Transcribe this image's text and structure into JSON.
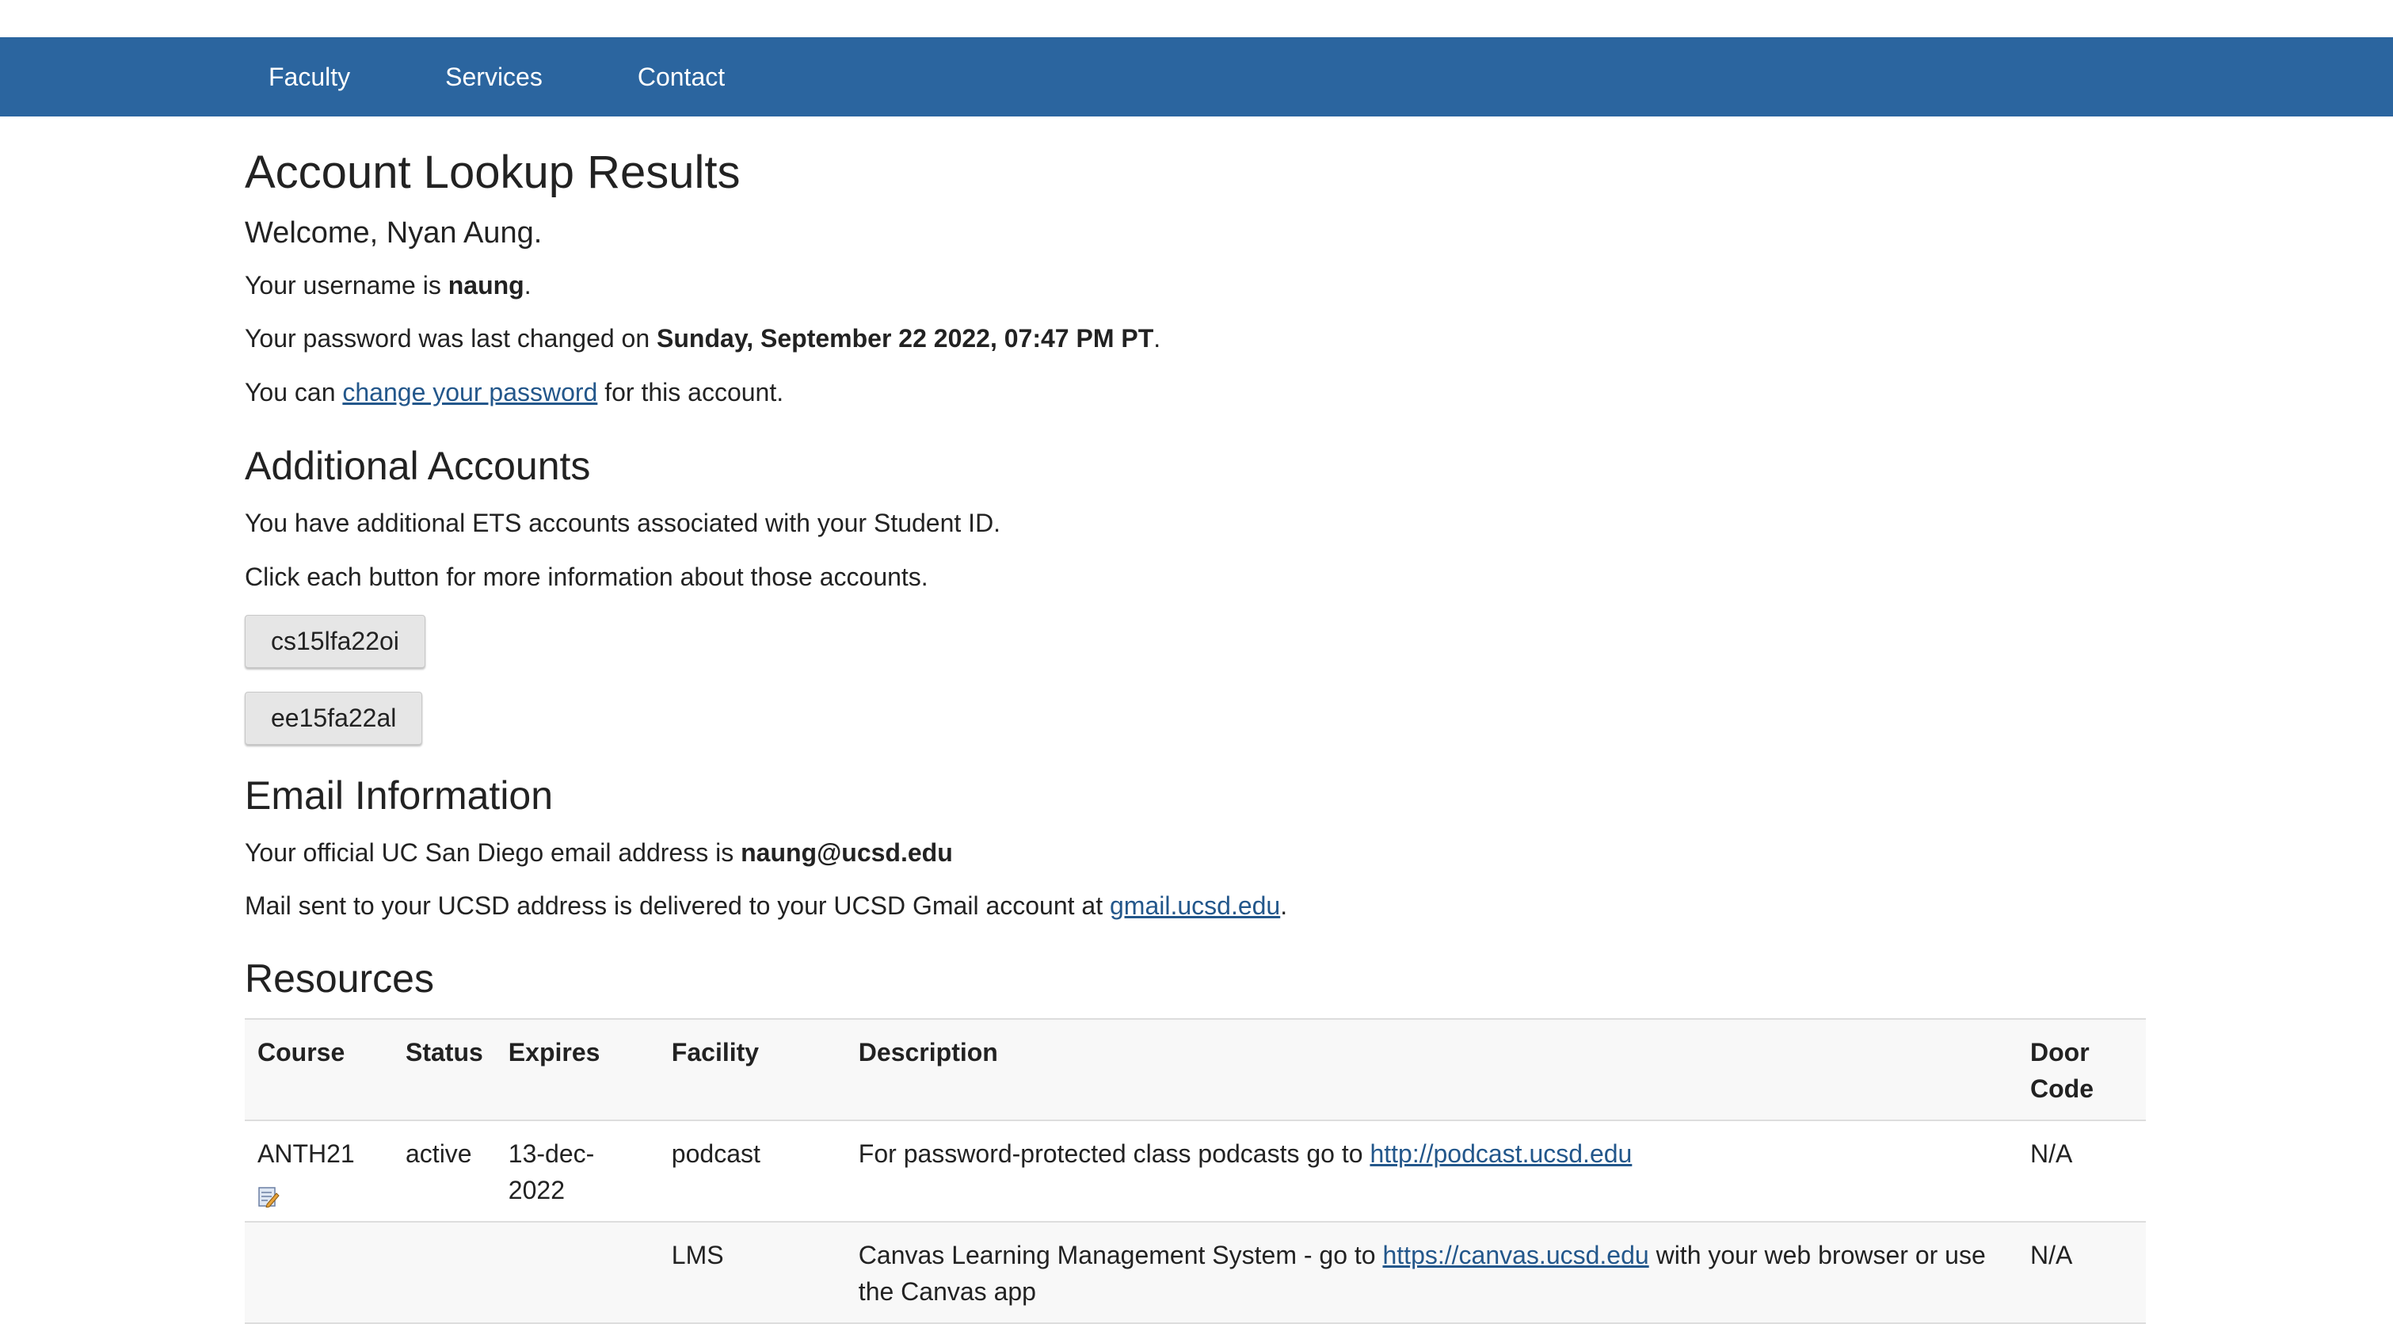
{
  "nav": {
    "items": [
      "Faculty",
      "Services",
      "Contact"
    ]
  },
  "page": {
    "title": "Account Lookup Results",
    "welcome": "Welcome, Nyan Aung."
  },
  "account": {
    "username_prefix": "Your username is ",
    "username": "naung",
    "password_prefix": "Your password was last changed on ",
    "password_changed": "Sunday, September 22 2022, 07:47 PM PT",
    "change_prefix": "You can ",
    "change_link": "change your password",
    "change_suffix": " for this account."
  },
  "additional": {
    "heading": "Additional Accounts",
    "line1": "You have additional ETS accounts associated with your Student ID.",
    "line2": "Click each button for more information about those accounts.",
    "buttons": [
      "cs15lfa22oi",
      "ee15fa22al"
    ]
  },
  "email": {
    "heading": "Email Information",
    "line1_prefix": "Your official UC San Diego email address is ",
    "address": "naung@ucsd.edu",
    "line2_prefix": "Mail sent to your UCSD address is delivered to your UCSD Gmail account at ",
    "gmail_link": "gmail.ucsd.edu",
    "line2_suffix": "."
  },
  "resources": {
    "heading": "Resources",
    "columns": [
      "Course",
      "Status",
      "Expires",
      "Facility",
      "Description",
      "Door Code"
    ],
    "rows": [
      {
        "course": "ANTH21",
        "status": "active",
        "expires": "13-dec-2022",
        "facility": "podcast",
        "desc_prefix": "For password-protected class podcasts go to ",
        "desc_link": "http://podcast.ucsd.edu",
        "desc_suffix": "",
        "door_code": "N/A"
      },
      {
        "course": "",
        "status": "",
        "expires": "",
        "facility": "LMS",
        "desc_prefix": "Canvas Learning Management System - go to ",
        "desc_link": "https://canvas.ucsd.edu",
        "desc_suffix": " with your web browser or use the Canvas app",
        "door_code": "N/A"
      }
    ]
  },
  "icons": {
    "edit": "edit-note-icon"
  }
}
